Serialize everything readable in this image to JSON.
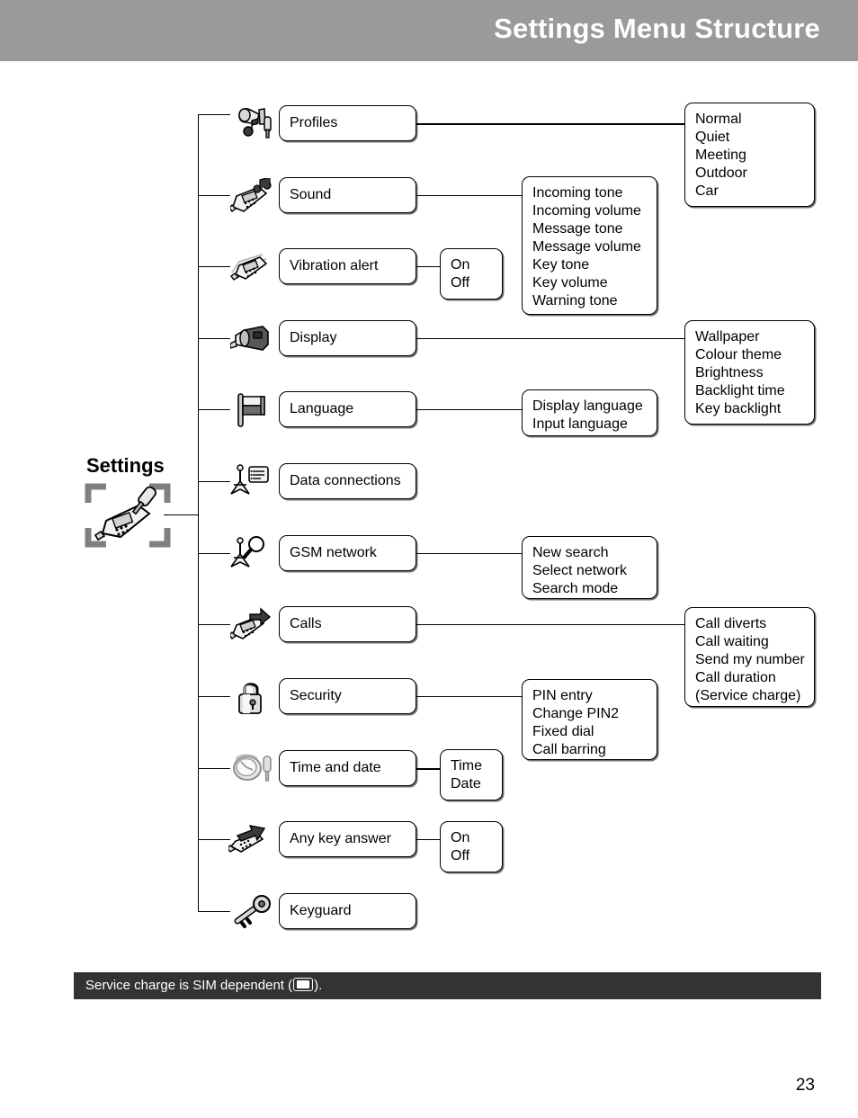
{
  "header": {
    "title": "Settings Menu Structure"
  },
  "root": {
    "label": "Settings",
    "icon": "phone-screwdriver-icon"
  },
  "menu": [
    {
      "label": "Profiles",
      "icon": "profiles-icon"
    },
    {
      "label": "Sound",
      "icon": "phone-music-note-icon"
    },
    {
      "label": "Vibration alert",
      "icon": "phone-vibrating-icon"
    },
    {
      "label": "Display",
      "icon": "projector-icon"
    },
    {
      "label": "Language",
      "icon": "flag-icon"
    },
    {
      "label": "Data connections",
      "icon": "antenna-list-icon"
    },
    {
      "label": "GSM network",
      "icon": "antenna-magnifier-icon"
    },
    {
      "label": "Calls",
      "icon": "phone-arrow-icon"
    },
    {
      "label": "Security",
      "icon": "padlock-icon"
    },
    {
      "label": "Time and date",
      "icon": "clock-screwdriver-icon"
    },
    {
      "label": "Any key answer",
      "icon": "phone-keys-arrow-icon"
    },
    {
      "label": "Keyguard",
      "icon": "key-icon"
    }
  ],
  "submenus": {
    "profiles": [
      "Normal",
      "Quiet",
      "Meeting",
      "Outdoor",
      "Car"
    ],
    "sound": [
      "Incoming tone",
      "Incoming volume",
      "Message tone",
      "Message volume",
      "Key tone",
      "Key volume",
      "Warning tone"
    ],
    "vibration": [
      "On",
      "Off"
    ],
    "display": [
      "Wallpaper",
      "Colour theme",
      "Brightness",
      "Backlight time",
      "Key backlight"
    ],
    "language": [
      "Display language",
      "Input language"
    ],
    "gsm_network": [
      "New search",
      "Select network",
      "Search mode"
    ],
    "calls": [
      "Call diverts",
      "Call waiting",
      "Send my number",
      "Call duration",
      "(Service charge)"
    ],
    "security": [
      "PIN entry",
      "Change PIN2",
      "Fixed dial",
      "Call barring"
    ],
    "time_and_date": [
      "Time",
      "Date"
    ],
    "any_key_answer": [
      "On",
      "Off"
    ]
  },
  "note": {
    "before": "Service charge is SIM dependent (",
    "after": ").",
    "icon": "sim-card-icon"
  },
  "page_number": "23",
  "colors": {
    "header_bg": "#9a9a9a",
    "note_bg": "#333333",
    "box_border": "#000000",
    "page_bg": "#ffffff"
  }
}
